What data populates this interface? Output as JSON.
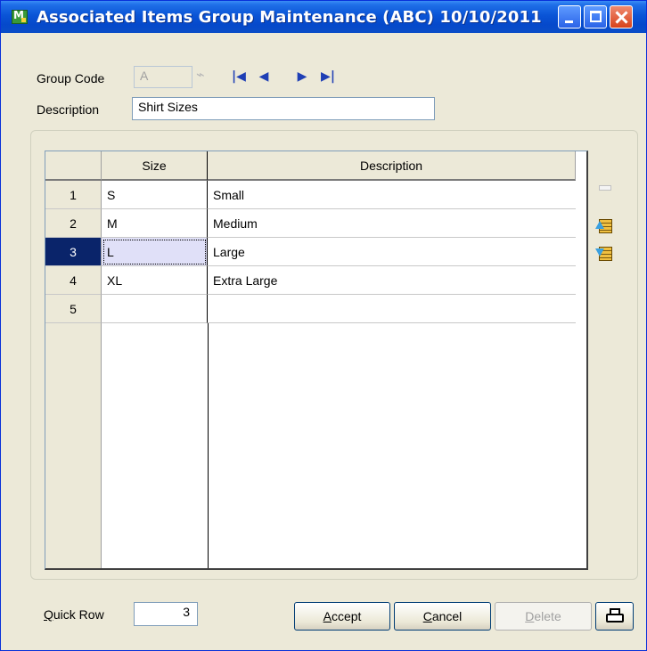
{
  "window": {
    "title": "Associated Items Group Maintenance (ABC) 10/10/2011"
  },
  "form": {
    "group_code_label": "Group Code",
    "group_code_value": "A",
    "description_label": "Description",
    "description_value": "Shirt Sizes"
  },
  "grid": {
    "columns": [
      "Size",
      "Description"
    ],
    "rows": [
      {
        "num": "1",
        "size": "S",
        "description": "Small"
      },
      {
        "num": "2",
        "size": "M",
        "description": "Medium"
      },
      {
        "num": "3",
        "size": "L",
        "description": "Large"
      },
      {
        "num": "4",
        "size": "XL",
        "description": "Extra Large"
      },
      {
        "num": "5",
        "size": "",
        "description": ""
      }
    ],
    "selected_row": "3"
  },
  "footer": {
    "quick_row_label_first": "Q",
    "quick_row_label_rest": "uick Row",
    "quick_row_value": "3",
    "accept_first": "A",
    "accept_rest": "ccept",
    "cancel_first": "C",
    "cancel_rest": "ancel",
    "delete_first": "D",
    "delete_rest": "elete"
  },
  "colors": {
    "titlebar": "#0a54d6",
    "selected_row": "#0a246a",
    "window_bg": "#ece9d8"
  }
}
